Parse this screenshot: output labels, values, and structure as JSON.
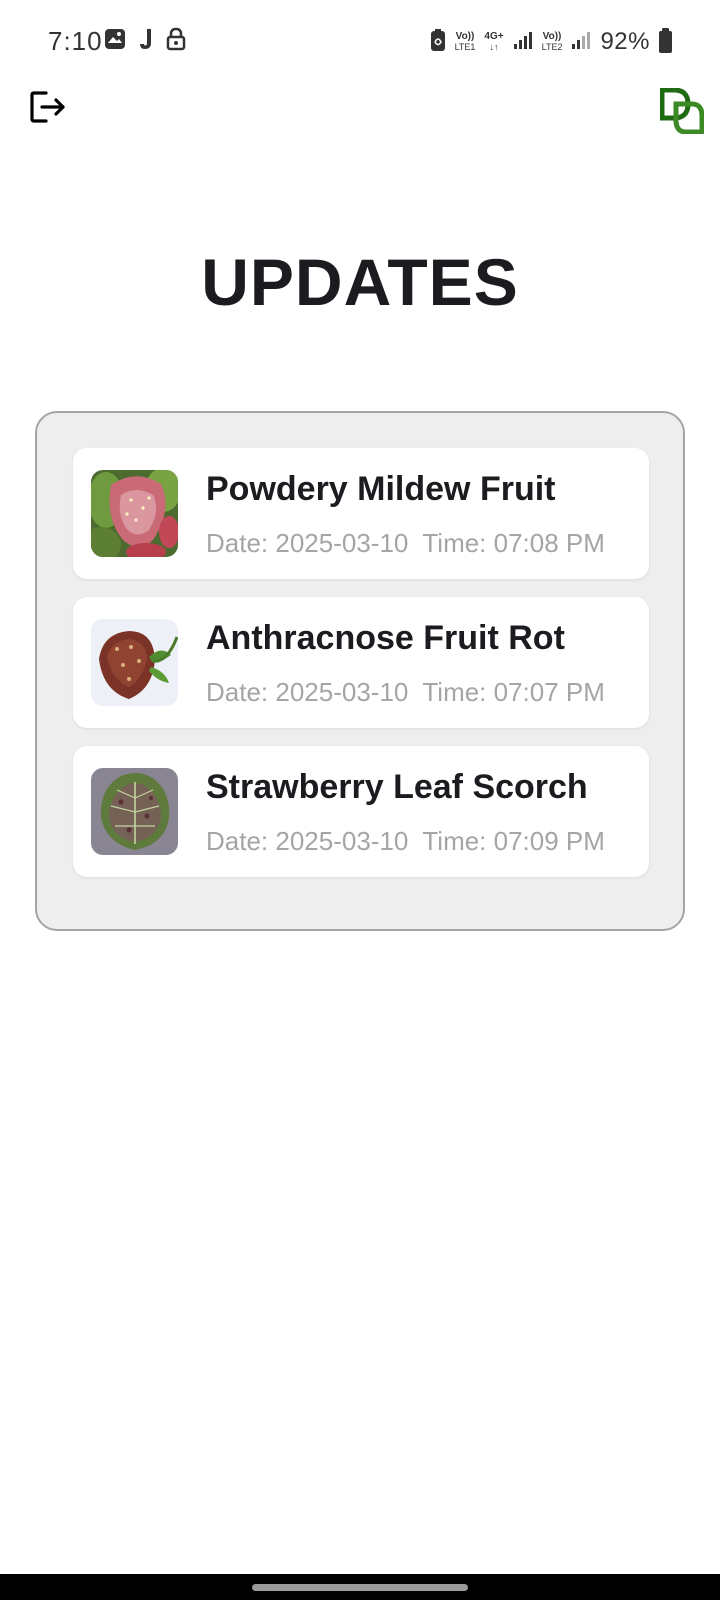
{
  "status_bar": {
    "time": "7:10",
    "sim1_top": "Vo))",
    "sim1_bottom": "LTE1",
    "network_type": "4G+",
    "sim2_top": "Vo))",
    "sim2_bottom": "LTE2",
    "battery_percent": "92%"
  },
  "page": {
    "title": "UPDATES"
  },
  "updates": [
    {
      "title": "Powdery Mildew Fruit",
      "date_label": "Date: 2025-03-10",
      "time_label": "Time: 07:08 PM"
    },
    {
      "title": "Anthracnose Fruit Rot",
      "date_label": "Date: 2025-03-10",
      "time_label": "Time: 07:07 PM"
    },
    {
      "title": "Strawberry Leaf Scorch",
      "date_label": "Date: 2025-03-10",
      "time_label": "Time: 07:09 PM"
    }
  ],
  "icons": {
    "logout": "logout-icon",
    "logo": "brand-logo",
    "status": [
      "gallery-icon",
      "j-icon",
      "lock-icon",
      "battery-saver-icon",
      "signal-icon",
      "battery-icon"
    ]
  },
  "colors": {
    "title": "#1c1b20",
    "meta_text": "#a5a5a5",
    "panel_bg": "#eeeeee",
    "panel_border": "#a5a5a5",
    "logo_green": "#2e7d1f"
  }
}
